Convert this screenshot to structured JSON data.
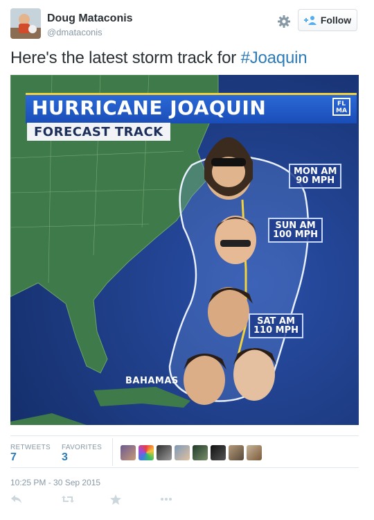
{
  "user": {
    "name": "Doug Mataconis",
    "handle": "@dmataconis"
  },
  "follow_button": {
    "label": "Follow"
  },
  "tweet": {
    "text_prefix": "Here's the latest storm track for ",
    "hashtag": "#Joaquin"
  },
  "graphic": {
    "title": "HURRICANE JOAQUIN",
    "subtitle": "FORECAST TRACK",
    "station_logo": "FL MA",
    "labels": [
      {
        "line1": "MON AM",
        "line2": "90 MPH"
      },
      {
        "line1": "SUN AM",
        "line2": "100 MPH"
      },
      {
        "line1": "SAT AM",
        "line2": "110 MPH"
      }
    ],
    "place": "BAHAMAS"
  },
  "stats": {
    "retweets_label": "RETWEETS",
    "retweets_value": "7",
    "favorites_label": "FAVORITES",
    "favorites_value": "3"
  },
  "timestamp": "10:25 PM - 30 Sep 2015",
  "colors": {
    "link": "#2b7bb9",
    "muted": "#8899a6",
    "text": "#292f33",
    "ocean": "#1c3a7a",
    "land": "#3f7a4a",
    "banner": "#2b69d6"
  },
  "icons": [
    "gear-icon",
    "follow-user-plus-icon",
    "reply-icon",
    "retweet-icon",
    "favorite-star-icon",
    "more-dots-icon"
  ]
}
